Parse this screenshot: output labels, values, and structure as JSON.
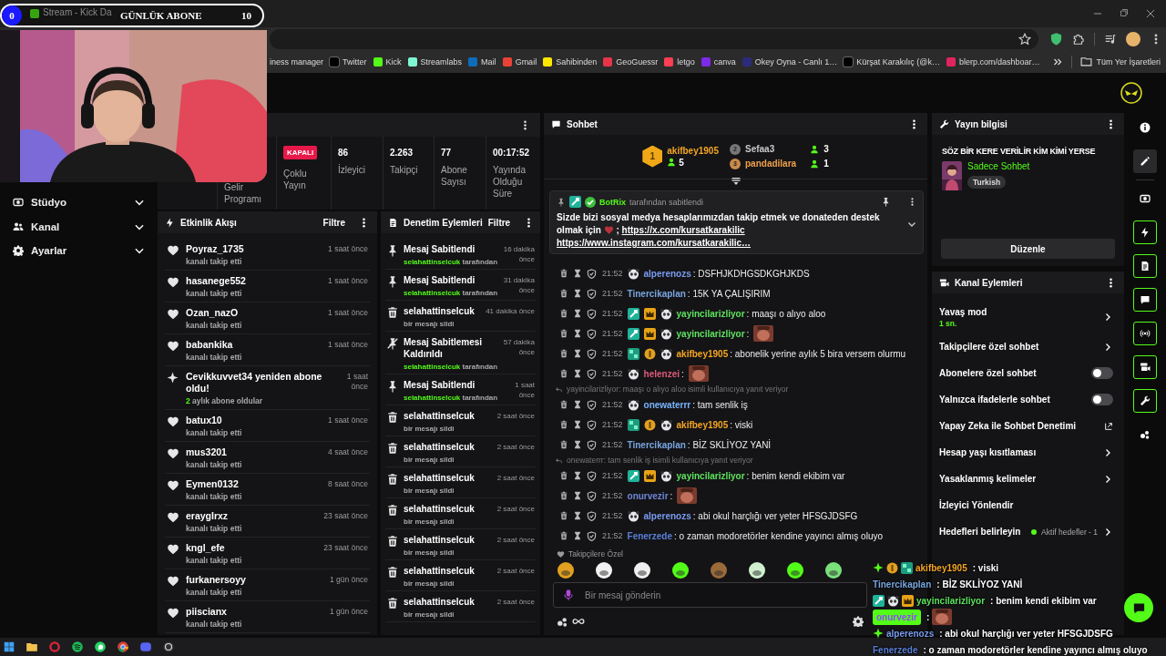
{
  "browser": {
    "tab": {
      "title": "Stream - Kick Da"
    },
    "bookmarks": [
      {
        "label": "iness manager"
      },
      {
        "label": "Twitter",
        "color": "#000000"
      },
      {
        "label": "Kick",
        "color": "#53fc18"
      },
      {
        "label": "Streamlabs",
        "color": "#80f5d2"
      },
      {
        "label": "Mail",
        "color": "#0f6cbd"
      },
      {
        "label": "Gmail",
        "color": "#ea4335"
      },
      {
        "label": "Sahibinden",
        "color": "#ffe800"
      },
      {
        "label": "GeoGuessr",
        "color": "#e8344a"
      },
      {
        "label": "letgo",
        "color": "#ff3f55"
      },
      {
        "label": "canva",
        "color": "#7d2ae8"
      },
      {
        "label": "Okey Oyna - Canlı 1…",
        "color": "#2b2b7a"
      },
      {
        "label": "Kürşat Karakılıç (@k…",
        "color": "#000000"
      },
      {
        "label": "blerp.com/dashboar…",
        "color": "#e0245e"
      }
    ],
    "all_bookmarks": "Tüm Yer İşaretleri"
  },
  "goal_bar": {
    "current": "0",
    "label": "GÜNLÜK ABONE",
    "target": "10",
    "level": 0
  },
  "sidebar": {
    "items": [
      {
        "label": "Stüdyo",
        "expanded": false
      },
      {
        "label": "Kanal",
        "expanded": false
      },
      {
        "label": "Ayarlar",
        "expanded": false
      }
    ]
  },
  "stats": [
    {
      "kind": "label",
      "label": "Gelir Programı"
    },
    {
      "kind": "badge",
      "value": "KAPALI",
      "label": "Çoklu Yayın"
    },
    {
      "kind": "number",
      "value": "86",
      "label": "İzleyici"
    },
    {
      "kind": "number",
      "value": "2.263",
      "label": "Takipçi"
    },
    {
      "kind": "number",
      "value": "77",
      "label": "Abone Sayısı"
    },
    {
      "kind": "number",
      "value": "00:17:52",
      "label": "Yayında Olduğu Süre"
    }
  ],
  "activity_feed": {
    "title": "Etkinlik Akışı",
    "filter": "Filtre",
    "items": [
      {
        "kind": "follow",
        "name": "Poyraz_1735",
        "detail": "kanalı takip etti",
        "time": "1 saat önce"
      },
      {
        "kind": "follow",
        "name": "hasanege552",
        "detail": "kanalı takip etti",
        "time": "1 saat önce"
      },
      {
        "kind": "follow",
        "name": "Ozan_nazO",
        "detail": "kanalı takip etti",
        "time": "1 saat önce"
      },
      {
        "kind": "follow",
        "name": "babankika",
        "detail": "kanalı takip etti",
        "time": "1 saat önce"
      },
      {
        "kind": "resub",
        "name": "Cevikkuvvet34 yeniden abone oldu!",
        "months": "2",
        "detail": "aylık abone oldular",
        "time": "1 saat önce"
      },
      {
        "kind": "follow",
        "name": "batux10",
        "detail": "kanalı takip etti",
        "time": "1 saat önce"
      },
      {
        "kind": "follow",
        "name": "mus3201",
        "detail": "kanalı takip etti",
        "time": "4 saat önce"
      },
      {
        "kind": "follow",
        "name": "Eymen0132",
        "detail": "kanalı takip etti",
        "time": "8 saat önce"
      },
      {
        "kind": "follow",
        "name": "eraygIrxz",
        "detail": "kanalı takip etti",
        "time": "23 saat önce"
      },
      {
        "kind": "follow",
        "name": "kngl_efe",
        "detail": "kanalı takip etti",
        "time": "23 saat önce"
      },
      {
        "kind": "follow",
        "name": "furkanersoyy",
        "detail": "kanalı takip etti",
        "time": "1 gün önce"
      },
      {
        "kind": "follow",
        "name": "piiscianx",
        "detail": "kanalı takip etti",
        "time": "1 gün önce"
      }
    ]
  },
  "moderation": {
    "title": "Denetim Eylemleri",
    "filter": "Filtre",
    "items": [
      {
        "kind": "pin",
        "title": "Mesaj Sabitlendi",
        "user": "selahattinselcuk",
        "detail": "tarafından",
        "time": "16 dakika önce"
      },
      {
        "kind": "pin",
        "title": "Mesaj Sabitlendi",
        "user": "selahattinselcuk",
        "detail": "tarafından",
        "time": "31 dakika önce"
      },
      {
        "kind": "delete",
        "title": "selahattinselcuk",
        "detail": "bir mesajı sildi",
        "time": "41 dakika önce"
      },
      {
        "kind": "unpin",
        "title": "Mesaj Sabitlemesi Kaldırıldı",
        "user": "selahattinselcuk",
        "detail": "tarafından",
        "time": "57 dakika önce"
      },
      {
        "kind": "pin",
        "title": "Mesaj Sabitlendi",
        "user": "selahattinselcuk",
        "detail": "tarafından",
        "time": "1 saat önce"
      },
      {
        "kind": "delete",
        "title": "selahattinselcuk",
        "detail": "bir mesajı sildi",
        "time": "2 saat önce"
      },
      {
        "kind": "delete",
        "title": "selahattinselcuk",
        "detail": "bir mesajı sildi",
        "time": "2 saat önce"
      },
      {
        "kind": "delete",
        "title": "selahattinselcuk",
        "detail": "bir mesajı sildi",
        "time": "2 saat önce"
      },
      {
        "kind": "delete",
        "title": "selahattinselcuk",
        "detail": "bir mesajı sildi",
        "time": "2 saat önce"
      },
      {
        "kind": "delete",
        "title": "selahattinselcuk",
        "detail": "bir mesajı sildi",
        "time": "2 saat önce"
      },
      {
        "kind": "delete",
        "title": "selahattinselcuk",
        "detail": "bir mesajı sildi",
        "time": "2 saat önce"
      },
      {
        "kind": "delete",
        "title": "selahattinselcuk",
        "detail": "bir mesajı sildi",
        "time": "2 saat önce"
      }
    ]
  },
  "chat": {
    "title": "Sohbet",
    "leaderboard": [
      {
        "rank": "1",
        "name": "akifbey1905",
        "color": "#f5a623",
        "count": "5"
      },
      {
        "rank": "2",
        "name": "Sefaa3",
        "color": "#c9c9c9",
        "count": "3"
      },
      {
        "rank": "3",
        "name": "pandadilara",
        "color": "#f0a04b",
        "count": "1"
      }
    ],
    "pinned": {
      "author": "BotRix",
      "note": "tarafından sabitlendi",
      "text": "Sizde bizi sosyal medya hesaplarımızdan takip etmek ve donateden destek olmak için",
      "separator": ";",
      "links": [
        "https://x.com/kursatkarakilic",
        "https://www.instagram.com/kursatkarakilic…"
      ]
    },
    "messages": [
      {
        "kind": "text",
        "time": "21:52",
        "badges": [
          {
            "kind": "panda"
          }
        ],
        "name": "alperenozs",
        "color": "#7a9cf0",
        "text": ": DSFHJKDHGSDKGHJKDS"
      },
      {
        "kind": "text",
        "time": "21:52",
        "name": "Tinercikaplan",
        "color": "#79a6e0",
        "text": ": 15K YA ÇALIŞIRIM"
      },
      {
        "kind": "text",
        "time": "21:52",
        "badges": [
          {
            "kind": "mod"
          },
          {
            "kind": "crown"
          },
          {
            "kind": "panda"
          }
        ],
        "name": "yayincilarizliyor",
        "color": "#5fe35f",
        "text": ": maaşı o alıyo aloo"
      },
      {
        "kind": "emote",
        "time": "21:52",
        "badges": [
          {
            "kind": "mod"
          },
          {
            "kind": "crown"
          },
          {
            "kind": "panda"
          }
        ],
        "name": "yayincilarizliyor",
        "color": "#5fe35f",
        "text": ":"
      },
      {
        "kind": "text",
        "time": "21:52",
        "badges": [
          {
            "kind": "sub"
          },
          {
            "kind": "gift"
          },
          {
            "kind": "panda"
          }
        ],
        "name": "akifbey1905",
        "color": "#f5a623",
        "text": ": abonelik yerine aylık 5 bira versem olurmu"
      },
      {
        "kind": "emote",
        "time": "21:52",
        "badges": [
          {
            "kind": "panda"
          }
        ],
        "name": "helenzei",
        "color": "#e05a7a",
        "text": ":"
      },
      {
        "kind": "reply",
        "text": "yayincilarizliyor: maaşı o alıyo aloo isimli kullanıcıya yanıt veriyor"
      },
      {
        "kind": "text",
        "time": "21:52",
        "badges": [
          {
            "kind": "panda"
          }
        ],
        "name": "onewaterrr",
        "color": "#79b4ff",
        "text": ": tam senlik iş"
      },
      {
        "kind": "text",
        "time": "21:52",
        "badges": [
          {
            "kind": "sub"
          },
          {
            "kind": "gift"
          },
          {
            "kind": "panda"
          }
        ],
        "name": "akifbey1905",
        "color": "#f5a623",
        "text": ": viski"
      },
      {
        "kind": "text",
        "time": "21:52",
        "name": "Tinercikaplan",
        "color": "#79a6e0",
        "text": ": BİZ SKLİYOZ YANİ"
      },
      {
        "kind": "reply",
        "text": "onewaterrr: tam senlik iş isimli kullanıcıya yanıt veriyor"
      },
      {
        "kind": "text",
        "time": "21:52",
        "badges": [
          {
            "kind": "mod"
          },
          {
            "kind": "crown"
          },
          {
            "kind": "panda"
          }
        ],
        "name": "yayincilarizliyor",
        "color": "#5fe35f",
        "text": ": benim kendi ekibim var"
      },
      {
        "kind": "emote",
        "time": "21:52",
        "name": "onurvezir",
        "color": "#6f86d6",
        "text": ":"
      },
      {
        "kind": "text",
        "time": "21:52",
        "badges": [
          {
            "kind": "panda"
          }
        ],
        "name": "alperenozs",
        "color": "#7a9cf0",
        "text": ": abi okul harçlığı ver yeter HFSGJDSFG"
      },
      {
        "kind": "text",
        "time": "21:52",
        "name": "Fenerzede",
        "color": "#5a7fd6",
        "text": ": o zaman modoretörler kendine yayıncı almış oluyo"
      }
    ],
    "emote_tab": "Takipçilere Özel",
    "input_placeholder": "Bir mesaj gönderin"
  },
  "stream_info": {
    "title": "Yayın bilgisi",
    "stream_title": "SÖZ BİR KERE VERİLİR KİM KİMİ YERSE",
    "category": "Sadece Sohbet",
    "tag": "Turkish",
    "edit": "Düzenle"
  },
  "channel_actions": {
    "title": "Kanal Eylemleri",
    "items": [
      {
        "kind": "link",
        "label": "Yavaş mod",
        "value": "1 sn."
      },
      {
        "kind": "link",
        "label": "Takipçilere özel sohbet"
      },
      {
        "kind": "toggle",
        "label": "Abonelere özel sohbet",
        "on": false
      },
      {
        "kind": "toggle",
        "label": "Yalnızca ifadelerle sohbet",
        "on": false
      },
      {
        "kind": "external",
        "label": "Yapay Zeka ile Sohbet Denetimi"
      },
      {
        "kind": "link",
        "label": "Hesap yaşı kısıtlaması"
      },
      {
        "kind": "link",
        "label": "Yasaklanmış kelimeler"
      },
      {
        "kind": "plain",
        "label": "İzleyici Yönlendir"
      },
      {
        "kind": "link",
        "label": "Hedefleri belirleyin",
        "status": "Aktif hedefler - 1"
      }
    ]
  },
  "rail": [
    {
      "selected": false,
      "active": false
    },
    {
      "selected": true,
      "active": false
    },
    {
      "selected": false,
      "active": false
    },
    {
      "selected": false,
      "active": true
    },
    {
      "selected": false,
      "active": true
    },
    {
      "selected": false,
      "active": true
    },
    {
      "selected": false,
      "active": true
    },
    {
      "selected": false,
      "active": true
    },
    {
      "selected": false,
      "active": true
    },
    {
      "selected": false,
      "active": false
    }
  ],
  "stream_overlay": [
    {
      "kind": "text",
      "badges": [
        {
          "kind": "sparkle"
        },
        {
          "kind": "gift"
        },
        {
          "kind": "sub"
        }
      ],
      "name": "akifbey1905",
      "color": "#f5a623",
      "highlighted": false,
      "text": ": viski"
    },
    {
      "kind": "text",
      "name": "Tinercikaplan",
      "color": "#79a6e0",
      "highlighted": false,
      "text": ": BİZ SKLİYOZ YANİ"
    },
    {
      "kind": "text",
      "badges": [
        {
          "kind": "mod"
        },
        {
          "kind": "panda"
        },
        {
          "kind": "crown"
        }
      ],
      "name": "yayincilarizliyor",
      "color": "#5fe35f",
      "highlighted": false,
      "text": ": benim kendi ekibim var"
    },
    {
      "kind": "emote",
      "name": "onurvezir",
      "color": "#9146ff",
      "highlighted": true,
      "text": ":"
    },
    {
      "kind": "text",
      "badges": [
        {
          "kind": "sparkle"
        }
      ],
      "name": "alperenozs",
      "color": "#7a9cf0",
      "highlighted": false,
      "text": ": abi okul harçlığı ver yeter HFSGJDSFG"
    },
    {
      "kind": "text",
      "name": "Fenerzede",
      "color": "#5a7fd6",
      "highlighted": false,
      "text": ": o zaman modoretörler kendine yayıncı almış oluyo"
    }
  ]
}
